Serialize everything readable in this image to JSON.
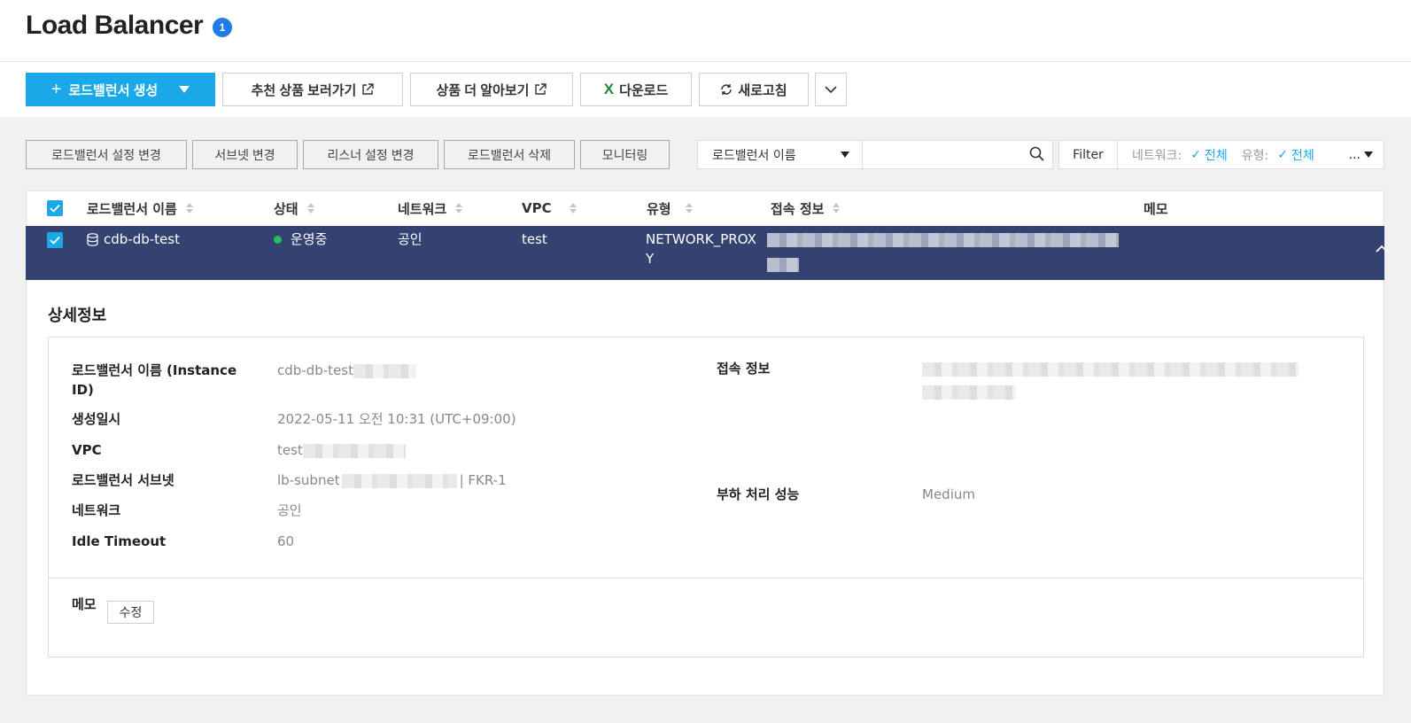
{
  "header": {
    "title": "Load Balancer",
    "badge_count": "1"
  },
  "toolbar": {
    "create_label": "로드밸런서 생성",
    "recommend_label": "추천 상품 보러가기",
    "learn_more_label": "상품 더 알아보기",
    "download_label": "다운로드",
    "refresh_label": "새로고침"
  },
  "actions": {
    "change_settings": "로드밸런서 설정 변경",
    "change_subnet": "서브넷 변경",
    "change_listener": "리스너 설정 변경",
    "delete": "로드밸런서 삭제",
    "monitoring": "모니터링"
  },
  "search": {
    "field": "로드밸런서 이름",
    "placeholder": ""
  },
  "filter": {
    "label": "Filter",
    "network_label": "네트워크:",
    "network_value": "전체",
    "type_label": "유형:",
    "type_value": "전체",
    "ellipsis": "..."
  },
  "table": {
    "columns": [
      "로드밸런서 이름",
      "상태",
      "네트워크",
      "VPC",
      "유형",
      "접속 정보",
      "메모"
    ],
    "row": {
      "name": "cdb-db-test",
      "status": "운영중",
      "network": "공인",
      "vpc": "test",
      "type_line1": "NETWORK_PROX",
      "type_line2": "Y"
    }
  },
  "detail": {
    "title": "상세정보",
    "name_label": "로드밸런서 이름 (Instance ID)",
    "name_value": "cdb-db-test",
    "created_label": "생성일시",
    "created_value": "2022-05-11 오전 10:31 (UTC+09:00)",
    "vpc_label": "VPC",
    "vpc_value": "test",
    "subnet_label": "로드밸런서 서브넷",
    "subnet_value": "lb-subnet",
    "subnet_zone": "| FKR-1",
    "network_label": "네트워크",
    "network_value": "공인",
    "idle_label": "Idle Timeout",
    "idle_value": "60",
    "access_label": "접속 정보",
    "performance_label": "부하 처리 성능",
    "performance_value": "Medium",
    "memo_label": "메모",
    "memo_edit": "수정"
  },
  "colors": {
    "primary": "#1aa8e9",
    "selected_row": "#334271",
    "status_running": "#22c25a",
    "badge": "#1f7ee3"
  }
}
